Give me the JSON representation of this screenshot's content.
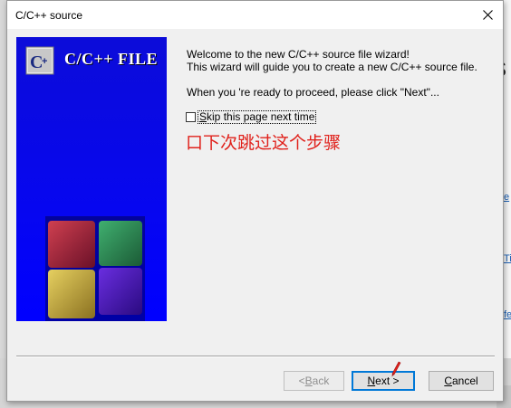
{
  "dialog": {
    "title": "C/C++ source",
    "banner_title": "C/C++ FILE",
    "welcome_line1": "Welcome to the new C/C++ source file wizard!",
    "welcome_line2": "This wizard will guide you to create a new C/C++ source file.",
    "proceed_text": "When you 're ready to proceed, please click \"Next\"...",
    "skip_checkbox": {
      "label_underlined": "S",
      "label_rest": "kip this page next time",
      "checked": false
    },
    "annotation": "口下次跳过这个步骤",
    "buttons": {
      "back_prefix": "< ",
      "back_underlined": "B",
      "back_rest": "ack",
      "next_underlined": "N",
      "next_rest": "ext >",
      "cancel_underlined": "C",
      "cancel_rest": "ancel"
    }
  },
  "background": {
    "big_letter": "s",
    "links": [
      "e",
      "Ti",
      "fe"
    ]
  },
  "icons": [
    "close-icon",
    "codeblocks-logo-icon",
    "cube-graphic",
    "mouse-cursor-icon"
  ],
  "colors": {
    "banner_blue": "#0707ee",
    "annotation_red": "#e0211b",
    "focus_blue": "#0078d7"
  }
}
